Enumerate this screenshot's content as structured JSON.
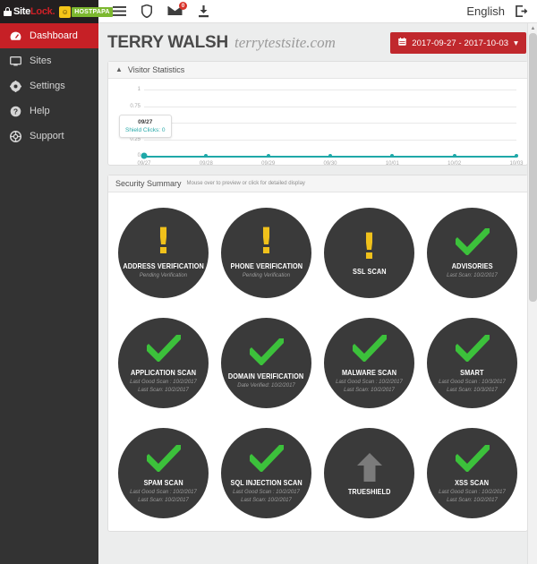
{
  "topbar": {
    "logo": {
      "site": "Site",
      "lock": "Lock",
      "dot": ".",
      "partner": "HOSTPAPA"
    },
    "icons": [
      {
        "name": "menu-icon",
        "glyph": "☰"
      },
      {
        "name": "shield-icon",
        "glyph": "⛊"
      },
      {
        "name": "mail-icon",
        "glyph": "✉",
        "badge": "0"
      },
      {
        "name": "download-icon",
        "glyph": "⤓"
      }
    ],
    "language": "English",
    "logout_icon": "logout-icon"
  },
  "sidebar": {
    "items": [
      {
        "label": "Dashboard",
        "icon": "dashboard-icon",
        "active": true
      },
      {
        "label": "Sites",
        "icon": "monitor-icon",
        "active": false
      },
      {
        "label": "Settings",
        "icon": "gear-icon",
        "active": false
      },
      {
        "label": "Help",
        "icon": "question-icon",
        "active": false
      },
      {
        "label": "Support",
        "icon": "lifebuoy-icon",
        "active": false
      }
    ]
  },
  "header": {
    "title": "TERRY WALSH",
    "domain": "terrytestsite.com",
    "date_range": "2017-09-27 - 2017-10-03",
    "date_icon": "calendar-icon",
    "date_caret": "▾"
  },
  "visitor_panel": {
    "title": "Visitor Statistics",
    "collapse_icon": "caret-up-icon"
  },
  "chart_data": {
    "type": "line",
    "title": "Visitor Statistics",
    "xlabel": "",
    "ylabel": "",
    "ylim": [
      0,
      1
    ],
    "yticks": [
      "1",
      "0.75",
      "0.5",
      "0.25",
      "0"
    ],
    "grid": true,
    "legend": "none",
    "categories": [
      "09/27",
      "09/28",
      "09/29",
      "09/30",
      "10/01",
      "10/02",
      "10/03"
    ],
    "series": [
      {
        "name": "Shield Clicks",
        "values": [
          0,
          0,
          0,
          0,
          0,
          0,
          0
        ],
        "color": "#1fa8a8"
      }
    ],
    "tooltip": {
      "label": "09/27",
      "value": "Shield Clicks: 0"
    }
  },
  "security_panel": {
    "title": "Security Summary",
    "subtitle": "Mouse over to preview or click for detailed display",
    "items": [
      {
        "name": "ADDRESS VERIFICATION",
        "status": "warning",
        "icon": "exclamation-icon",
        "lines": [
          "Pending Verification"
        ]
      },
      {
        "name": "PHONE VERIFICATION",
        "status": "warning",
        "icon": "exclamation-icon",
        "lines": [
          "Pending Verification"
        ]
      },
      {
        "name": "SSL SCAN",
        "status": "warning",
        "icon": "exclamation-icon",
        "lines": []
      },
      {
        "name": "ADVISORIES",
        "status": "ok",
        "icon": "check-icon",
        "lines": [
          "Last Scan: 10/2/2017"
        ]
      },
      {
        "name": "APPLICATION SCAN",
        "status": "ok",
        "icon": "check-icon",
        "lines": [
          "Last Good Scan : 10/2/2017",
          "Last Scan: 10/2/2017"
        ]
      },
      {
        "name": "DOMAIN VERIFICATION",
        "status": "ok",
        "icon": "check-icon",
        "lines": [
          "Date Verified: 10/2/2017"
        ]
      },
      {
        "name": "MALWARE SCAN",
        "status": "ok",
        "icon": "check-icon",
        "lines": [
          "Last Good Scan : 10/2/2017",
          "Last Scan: 10/2/2017"
        ]
      },
      {
        "name": "SMART",
        "status": "ok",
        "icon": "check-icon",
        "lines": [
          "Last Good Scan : 10/3/2017",
          "Last Scan: 10/3/2017"
        ]
      },
      {
        "name": "SPAM SCAN",
        "status": "ok",
        "icon": "check-icon",
        "lines": [
          "Last Good Scan : 10/2/2017",
          "Last Scan: 10/2/2017"
        ]
      },
      {
        "name": "SQL INJECTION SCAN",
        "status": "ok",
        "icon": "check-icon",
        "lines": [
          "Last Good Scan : 10/2/2017",
          "Last Scan: 10/2/2017"
        ]
      },
      {
        "name": "TRUESHIELD",
        "status": "neutral",
        "icon": "up-arrow-icon",
        "lines": []
      },
      {
        "name": "XSS SCAN",
        "status": "ok",
        "icon": "check-icon",
        "lines": [
          "Last Good Scan : 10/2/2017",
          "Last Scan: 10/2/2017"
        ]
      }
    ]
  },
  "scrollbar": {
    "up_arrow": "▲",
    "down_arrow": "▼"
  },
  "colors": {
    "accent_red": "#c0282d",
    "sidebar_dark": "#333333",
    "circle_dark": "#3a3a3a",
    "ok_green": "#3cc13b",
    "warn_yellow": "#f0c11b",
    "chart_teal": "#1fa8a8"
  }
}
